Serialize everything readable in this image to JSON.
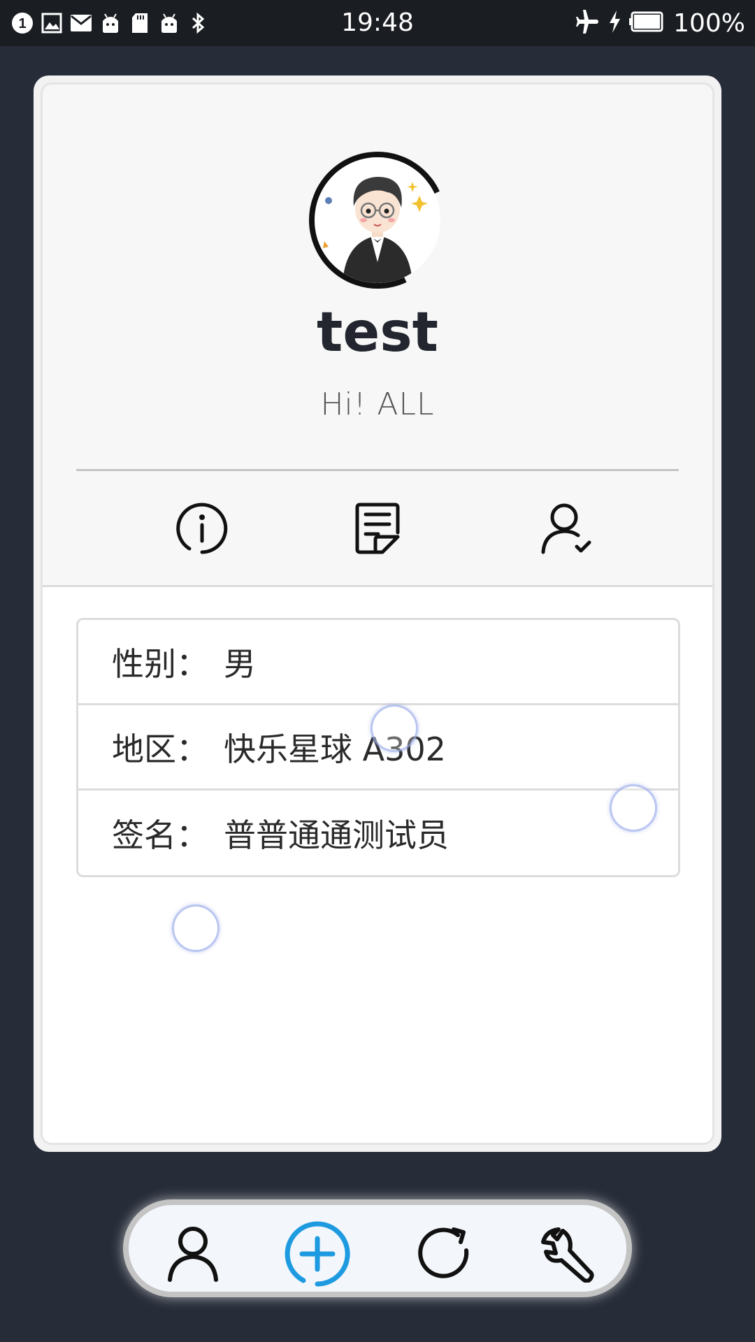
{
  "status_bar": {
    "time": "19:48",
    "battery": "100%",
    "left_icons": [
      "notification-count-icon",
      "image-icon",
      "mail-icon",
      "android-icon",
      "sd-card-icon",
      "android-icon",
      "bluetooth-icon"
    ],
    "notification_count": "1",
    "right_icons": [
      "airplane-icon",
      "charging-icon",
      "battery-icon"
    ]
  },
  "profile": {
    "name": "test",
    "tagline": "Hi! ALL",
    "tabs": [
      "info-icon",
      "note-icon",
      "user-check-icon"
    ]
  },
  "info": [
    {
      "label": "性别：",
      "value": "男"
    },
    {
      "label": "地区：",
      "value": "快乐星球 A302"
    },
    {
      "label": "签名：",
      "value": "普普通通测试员"
    }
  ],
  "bottom_nav": {
    "items": [
      "user-icon",
      "add-circle-icon",
      "refresh-icon",
      "wrench-icon"
    ],
    "active_color": "#1e9be0"
  }
}
